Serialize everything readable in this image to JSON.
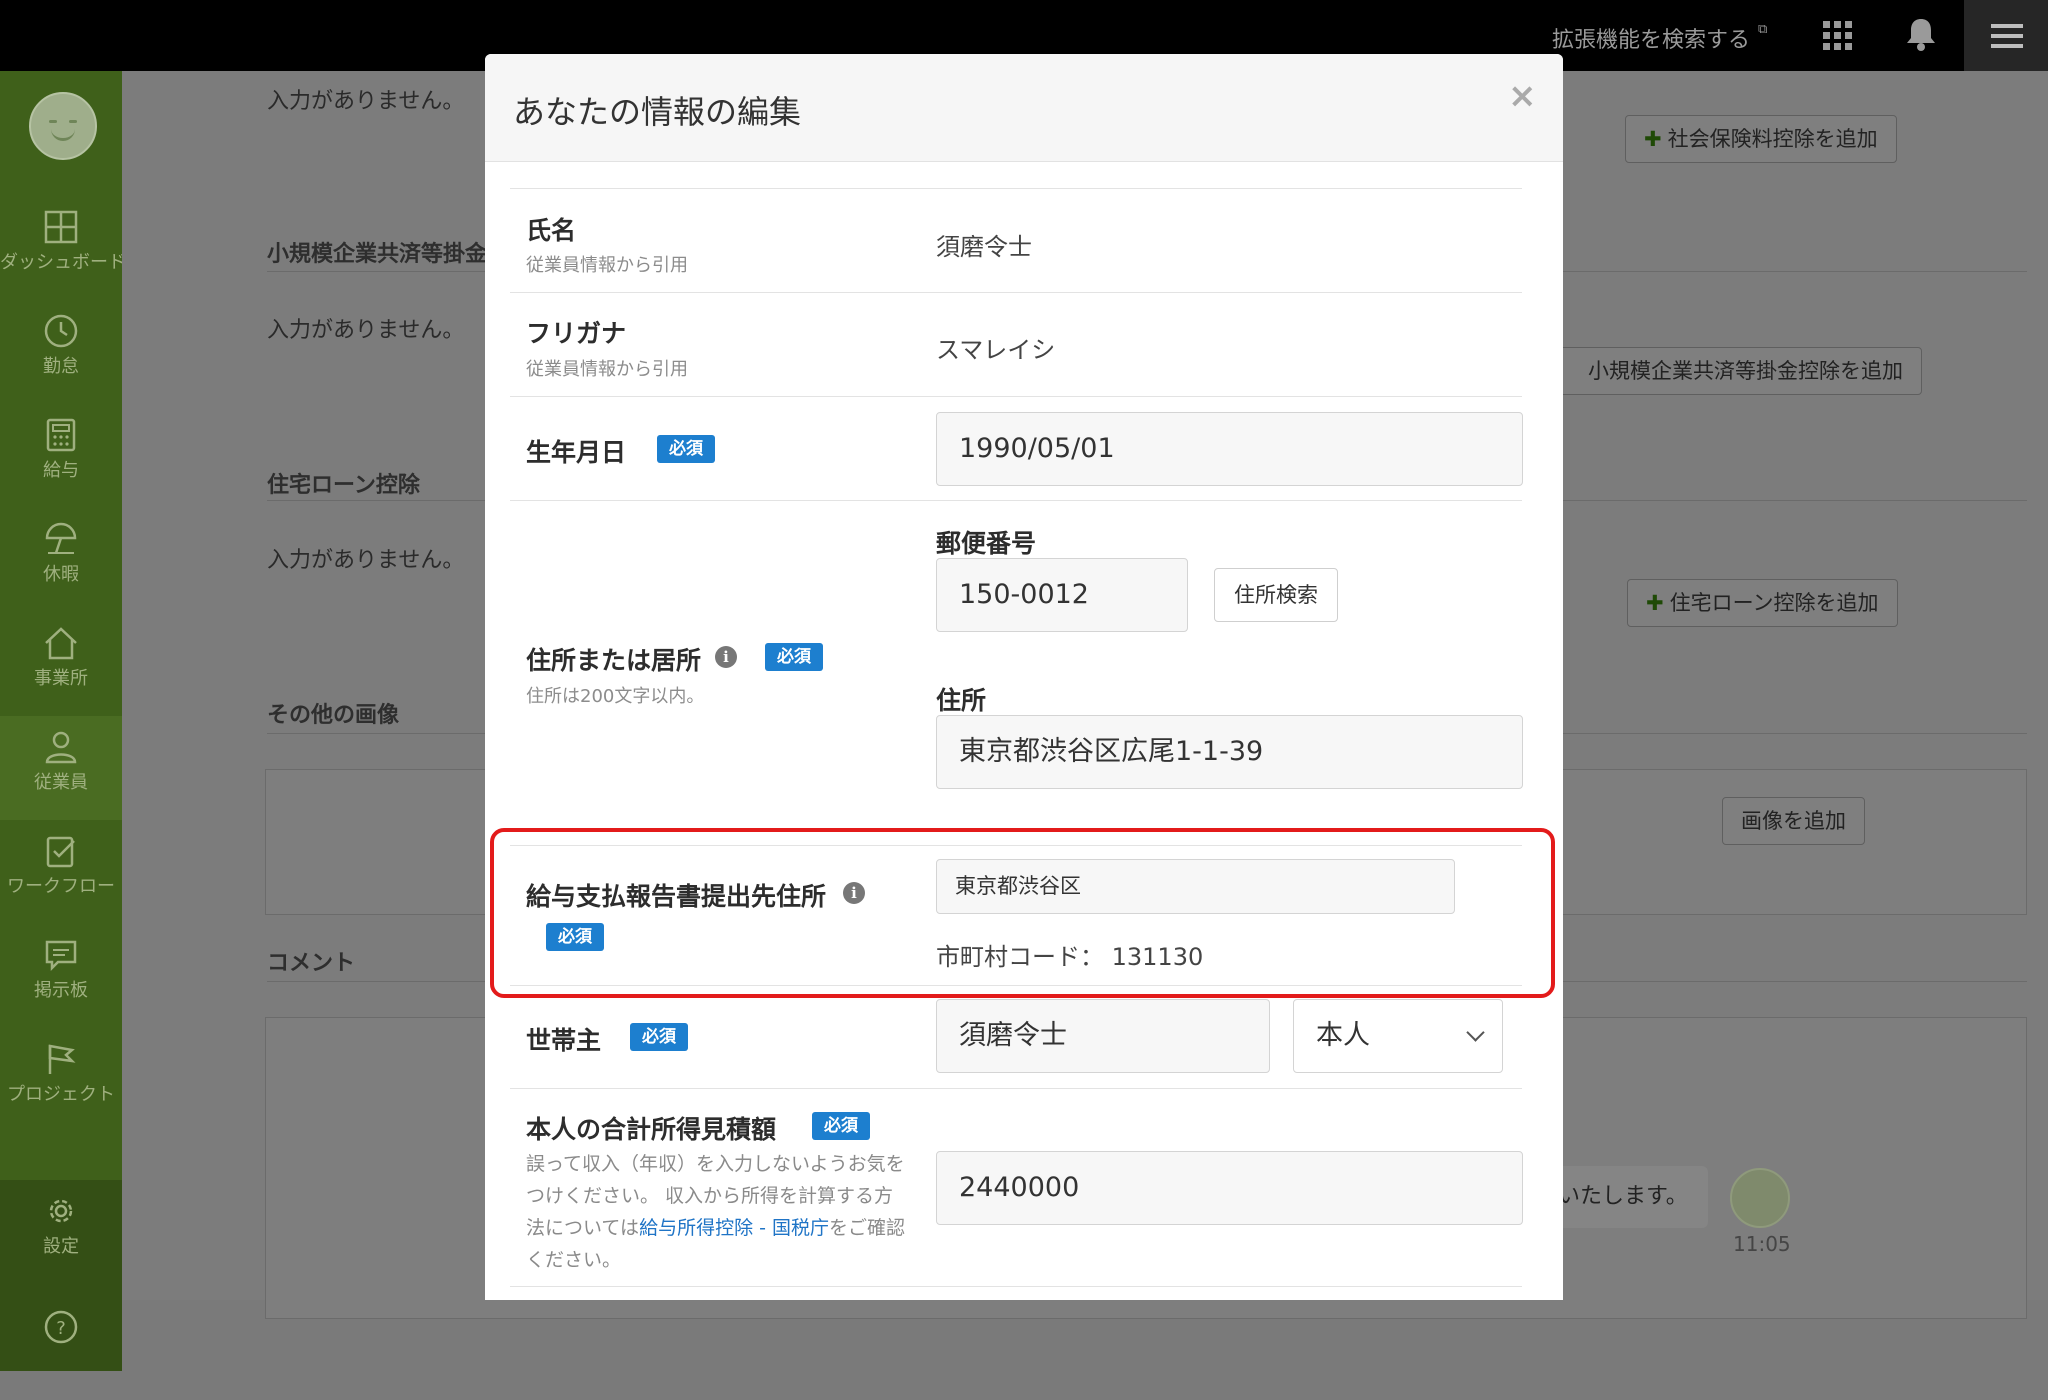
{
  "topbar": {
    "extensions_link": "拡張機能を検索する"
  },
  "sidebar": {
    "items": [
      {
        "label": "ダッシュボード",
        "icon": "dashboard-icon"
      },
      {
        "label": "勤怠",
        "icon": "clock-icon"
      },
      {
        "label": "給与",
        "icon": "calculator-icon"
      },
      {
        "label": "休暇",
        "icon": "parasol-icon"
      },
      {
        "label": "事業所",
        "icon": "home-icon"
      },
      {
        "label": "従業員",
        "icon": "person-icon",
        "active": true
      },
      {
        "label": "ワークフロー",
        "icon": "checklist-icon"
      },
      {
        "label": "掲示板",
        "icon": "chat-icon"
      },
      {
        "label": "プロジェクト",
        "icon": "flag-icon"
      },
      {
        "label": "設定",
        "icon": "gear-icon"
      }
    ]
  },
  "background": {
    "no_input_text": "入力がありません。",
    "sections": {
      "small_business": "小規模企業共済等掛金控除",
      "housing_loan": "住宅ローン控除",
      "other_images": "その他の画像",
      "comments": "コメント"
    },
    "buttons": {
      "add_social_insurance": "社会保険料控除を追加",
      "add_small_business": "小規模企業共済等掛金控除を追加",
      "add_housing_loan": "住宅ローン控除を追加",
      "add_image": "画像を追加"
    },
    "chat": {
      "message_fragment": "いたします。",
      "time": "11:05"
    }
  },
  "modal": {
    "title": "あなたの情報の編集",
    "close_symbol": "×",
    "required_badge": "必須",
    "fields": {
      "name": {
        "label": "氏名",
        "sub": "従業員情報から引用",
        "value": "須磨令士"
      },
      "furigana": {
        "label": "フリガナ",
        "sub": "従業員情報から引用",
        "value": "スマレイシ"
      },
      "birthdate": {
        "label": "生年月日",
        "value": "1990/05/01"
      },
      "address": {
        "label": "住所または居所",
        "sub": "住所は200文字以内。",
        "postal_label": "郵便番号",
        "postal_value": "150-0012",
        "search_button": "住所検索",
        "address_label": "住所",
        "address_value": "東京都渋谷区広尾1-1-39"
      },
      "payroll_report": {
        "label": "給与支払報告書提出先住所",
        "value": "東京都渋谷区",
        "code_text": "市町村コード： 131130"
      },
      "householder": {
        "label": "世帯主",
        "name_value": "須磨令士",
        "relation_value": "本人"
      },
      "income": {
        "label": "本人の合計所得見積額",
        "help_before": "誤って収入（年収）を入力しないようお気をつけください。 収入から所得を計算する方法については",
        "help_link": "給与所得控除 - 国税庁",
        "help_after": "をご確認ください。",
        "value": "2440000"
      }
    }
  }
}
